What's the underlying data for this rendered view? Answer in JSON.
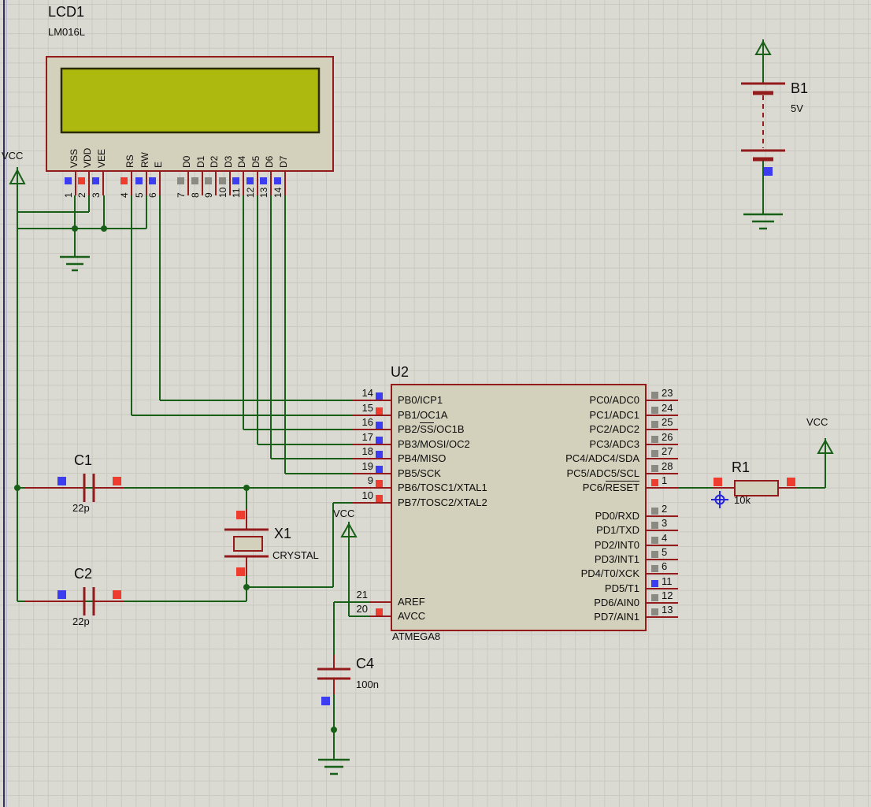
{
  "colors": {
    "background": "#dadad2",
    "grid": "#c9c9c1",
    "wire": "#186018",
    "component": "#941b1b",
    "chip_fill": "#d3d0bb",
    "screen_fill": "#adb90e",
    "screen_border": "#2b2b08",
    "pin_blue": "#3c3cf0",
    "pin_red": "#ee3c2e",
    "pin_gray": "#8a8a82",
    "marker_blue": "#2424d8",
    "border_navy": "#30305a",
    "border_lavender": "#b9b9d8"
  },
  "power": {
    "vcc_left": "VCC",
    "vcc_mid": "VCC",
    "vcc_right": "VCC"
  },
  "lcd": {
    "ref": "LCD1",
    "value": "LM016L",
    "pins": [
      {
        "num": "1",
        "name": "VSS",
        "color": "blue"
      },
      {
        "num": "2",
        "name": "VDD",
        "color": "red"
      },
      {
        "num": "3",
        "name": "VEE",
        "color": "blue"
      },
      {
        "num": "4",
        "name": "RS",
        "color": "red"
      },
      {
        "num": "5",
        "name": "RW",
        "color": "blue"
      },
      {
        "num": "6",
        "name": "E",
        "color": "blue"
      },
      {
        "num": "7",
        "name": "D0",
        "color": "gray"
      },
      {
        "num": "8",
        "name": "D1",
        "color": "gray"
      },
      {
        "num": "9",
        "name": "D2",
        "color": "gray"
      },
      {
        "num": "10",
        "name": "D3",
        "color": "gray"
      },
      {
        "num": "11",
        "name": "D4",
        "color": "blue"
      },
      {
        "num": "12",
        "name": "D5",
        "color": "blue"
      },
      {
        "num": "13",
        "name": "D6",
        "color": "blue"
      },
      {
        "num": "14",
        "name": "D7",
        "color": "blue"
      }
    ]
  },
  "mcu": {
    "ref": "U2",
    "value": "ATMEGA8",
    "left_pins": [
      {
        "num": "14",
        "label": "PB0/ICP1",
        "color": "blue"
      },
      {
        "num": "15",
        "label": "PB1/OC1A",
        "color": "red"
      },
      {
        "num": "16",
        "label": "PB2/SS/OC1B",
        "overline": "SS",
        "color": "blue"
      },
      {
        "num": "17",
        "label": "PB3/MOSI/OC2",
        "color": "blue"
      },
      {
        "num": "18",
        "label": "PB4/MISO",
        "color": "blue"
      },
      {
        "num": "19",
        "label": "PB5/SCK",
        "color": "blue"
      },
      {
        "num": "9",
        "label": "PB6/TOSC1/XTAL1",
        "color": "red"
      },
      {
        "num": "10",
        "label": "PB7/TOSC2/XTAL2",
        "color": "red"
      }
    ],
    "bottom_left_pins": [
      {
        "num": "21",
        "label": "AREF",
        "color": "none"
      },
      {
        "num": "20",
        "label": "AVCC",
        "color": "red"
      }
    ],
    "right_pins_top": [
      {
        "num": "23",
        "label": "PC0/ADC0",
        "color": "gray"
      },
      {
        "num": "24",
        "label": "PC1/ADC1",
        "color": "gray"
      },
      {
        "num": "25",
        "label": "PC2/ADC2",
        "color": "gray"
      },
      {
        "num": "26",
        "label": "PC3/ADC3",
        "color": "gray"
      },
      {
        "num": "27",
        "label": "PC4/ADC4/SDA",
        "color": "gray"
      },
      {
        "num": "28",
        "label": "PC5/ADC5/SCL",
        "color": "gray"
      },
      {
        "num": "1",
        "label": "PC6/RESET",
        "overline": "RESET",
        "color": "red"
      }
    ],
    "right_pins_bottom": [
      {
        "num": "2",
        "label": "PD0/RXD",
        "color": "gray"
      },
      {
        "num": "3",
        "label": "PD1/TXD",
        "color": "gray"
      },
      {
        "num": "4",
        "label": "PD2/INT0",
        "color": "gray"
      },
      {
        "num": "5",
        "label": "PD3/INT1",
        "color": "gray"
      },
      {
        "num": "6",
        "label": "PD4/T0/XCK",
        "color": "gray"
      },
      {
        "num": "11",
        "label": "PD5/T1",
        "color": "blue"
      },
      {
        "num": "12",
        "label": "PD6/AIN0",
        "color": "gray"
      },
      {
        "num": "13",
        "label": "PD7/AIN1",
        "color": "gray"
      }
    ]
  },
  "battery": {
    "ref": "B1",
    "value": "5V"
  },
  "capacitors": [
    {
      "ref": "C1",
      "value": "22p"
    },
    {
      "ref": "C2",
      "value": "22p"
    },
    {
      "ref": "C4",
      "value": "100n"
    }
  ],
  "crystal": {
    "ref": "X1",
    "value": "CRYSTAL"
  },
  "resistor": {
    "ref": "R1",
    "value": "10k"
  }
}
